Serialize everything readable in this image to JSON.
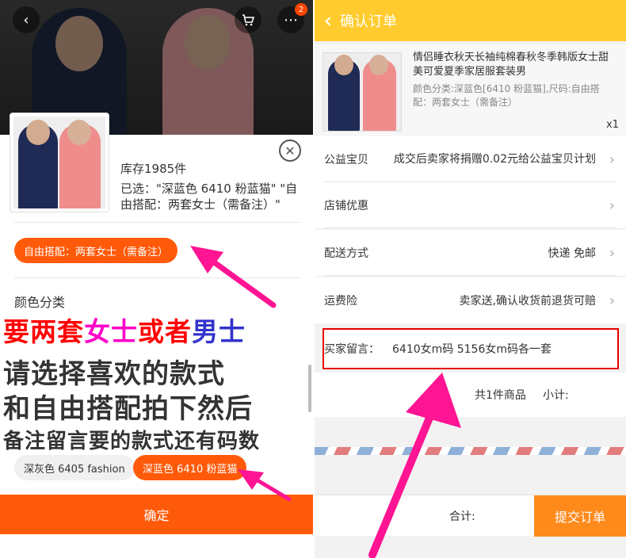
{
  "colors": {
    "accent_orange": "#ff5a0a",
    "header_yellow": "#ffcb2e",
    "submit_orange": "#ff8a1c",
    "annotation_red": "#ff0000",
    "annotation_pink": "#ff00c8",
    "annotation_blue": "#3333cc",
    "arrow_pink": "#ff1493"
  },
  "left": {
    "hero": {
      "back_icon": "chevron-left-icon",
      "cart_icon": "cart-icon",
      "more_icon": "more-icon",
      "cart_badge": "2"
    },
    "sku": {
      "stock": "库存1985件",
      "selected": "已选：\"深蓝色 6410 粉蓝猫\" \"自由搭配：两套女士（需备注）\"",
      "close_icon": "close-icon"
    },
    "selected_style_chip": "自由搭配：两套女士（需备注）",
    "color_section_title": "颜色分类",
    "annotation": {
      "line1_a": "要两套",
      "line1_b": "女士",
      "line1_c": "或者",
      "line1_d": "男士",
      "line2": "请选择喜欢的款式",
      "line3": "和自由搭配拍下然后",
      "line4": "备注留言要的款式还有码数"
    },
    "color_options": [
      {
        "label": "深灰色 6405 fashion",
        "selected": false
      },
      {
        "label": "深蓝色 6410 粉蓝猫",
        "selected": true
      }
    ],
    "confirm_label": "确定"
  },
  "right": {
    "title": "确认订单",
    "back_icon": "chevron-left-icon",
    "item": {
      "name": "情侣睡衣秋天长袖纯棉春秋冬季韩版女士甜美可爱夏季家居服套装男",
      "spec": "颜色分类:深蓝色[6410 粉蓝猫],尺码:自由搭配：两套女士（需备注）",
      "qty": "x1"
    },
    "rows": [
      {
        "label": "公益宝贝",
        "value": "成交后卖家将捐赠0.02元给公益宝贝计划"
      },
      {
        "label": "店铺优惠",
        "value": ""
      },
      {
        "label": "配送方式",
        "value": "快递 免邮"
      },
      {
        "label": "运费险",
        "value": "卖家送,确认收货前退货可赔"
      }
    ],
    "message": {
      "label": "买家留言：",
      "text": "6410女m码 5156女m码各一套"
    },
    "summary": {
      "count": "共1件商品",
      "subtotal": "小计:"
    },
    "bottom": {
      "total": "合计:",
      "submit": "提交订单"
    }
  }
}
